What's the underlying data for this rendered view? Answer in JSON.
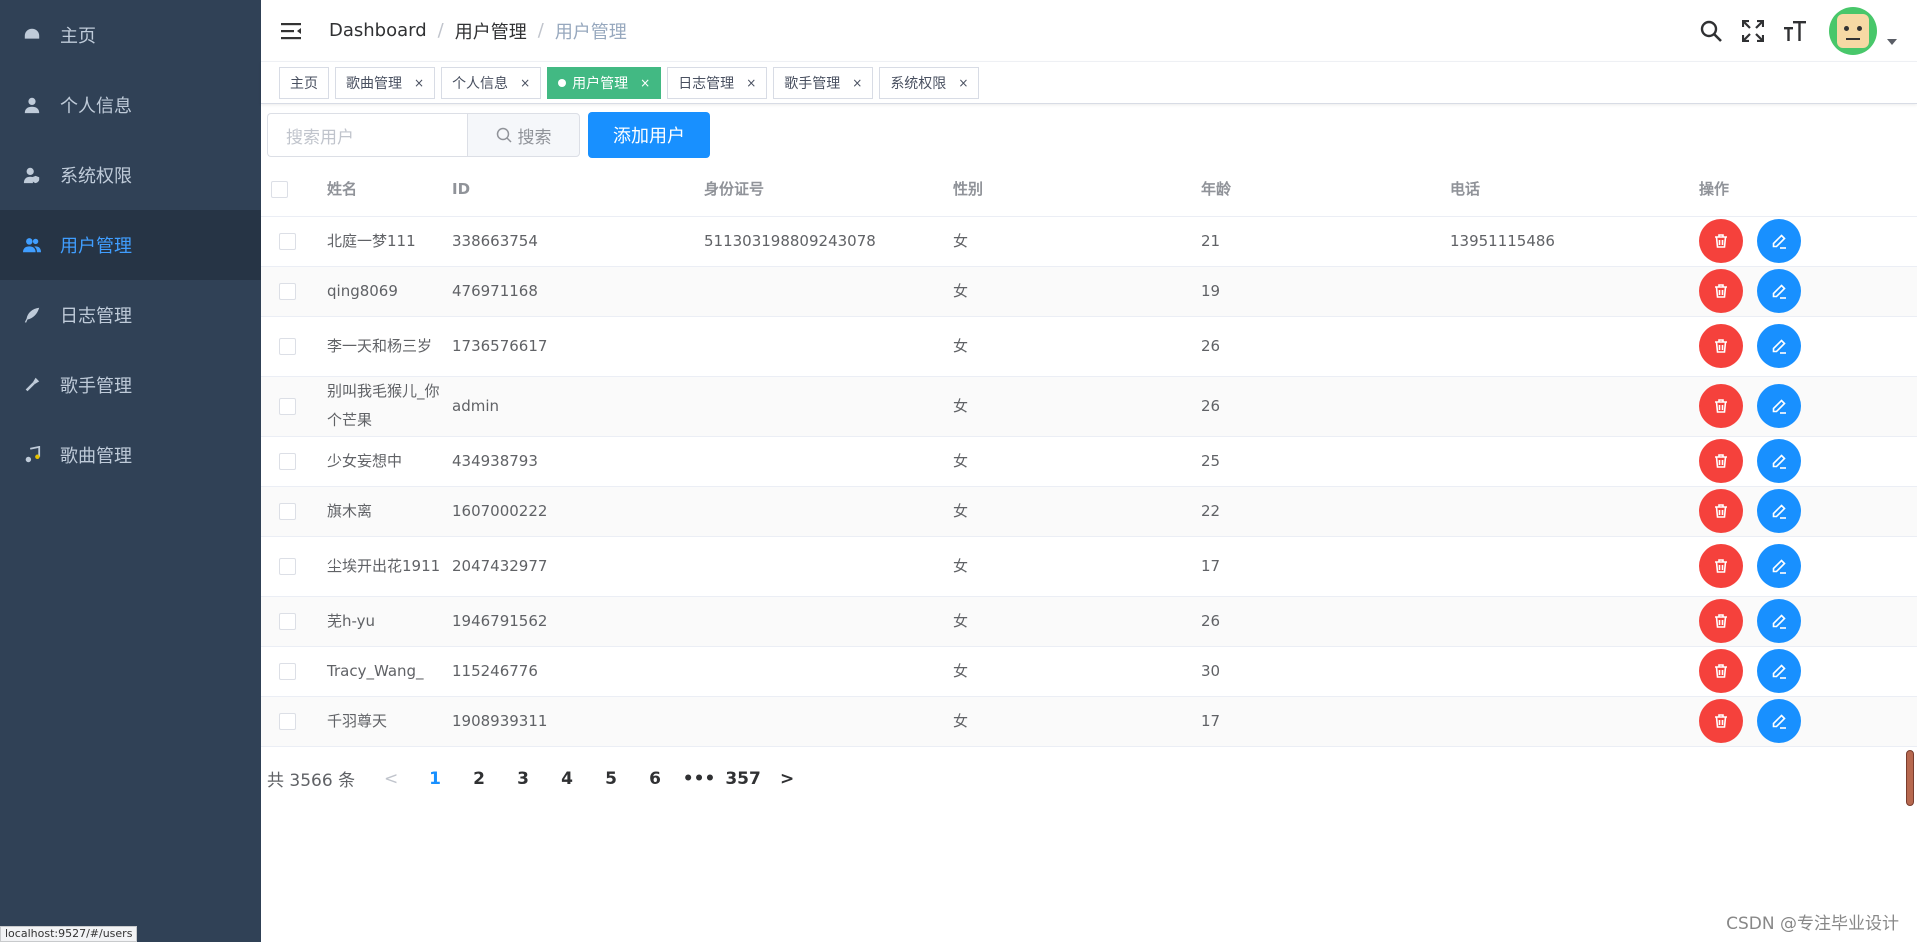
{
  "sidebar": {
    "items": [
      {
        "label": "主页",
        "icon": "dashboard-icon",
        "active": false
      },
      {
        "label": "个人信息",
        "icon": "user-icon",
        "active": false
      },
      {
        "label": "系统权限",
        "icon": "user-shield-icon",
        "active": false
      },
      {
        "label": "用户管理",
        "icon": "users-icon",
        "active": true
      },
      {
        "label": "日志管理",
        "icon": "feather-icon",
        "active": false
      },
      {
        "label": "歌手管理",
        "icon": "microphone-icon",
        "active": false
      },
      {
        "label": "歌曲管理",
        "icon": "music-icon",
        "active": false
      }
    ],
    "bg_color": "#304156",
    "active_color": "#409eff"
  },
  "breadcrumb": [
    "Dashboard",
    "用户管理",
    "用户管理"
  ],
  "tags": [
    {
      "label": "主页",
      "closable": false,
      "active": false
    },
    {
      "label": "歌曲管理",
      "closable": true,
      "active": false
    },
    {
      "label": "个人信息",
      "closable": true,
      "active": false
    },
    {
      "label": "用户管理",
      "closable": true,
      "active": true
    },
    {
      "label": "日志管理",
      "closable": true,
      "active": false
    },
    {
      "label": "歌手管理",
      "closable": true,
      "active": false
    },
    {
      "label": "系统权限",
      "closable": true,
      "active": false
    }
  ],
  "toolbar": {
    "search_placeholder": "搜索用户",
    "search_button": "搜索",
    "add_button": "添加用户"
  },
  "table": {
    "headers": [
      "姓名",
      "ID",
      "身份证号",
      "性别",
      "年龄",
      "电话",
      "操作"
    ],
    "rows": [
      {
        "name": "北庭一梦111",
        "id": "338663754",
        "idcard": "511303198809243078",
        "gender": "女",
        "age": "21",
        "phone": "13951115486"
      },
      {
        "name": "qing8069",
        "id": "476971168",
        "idcard": "",
        "gender": "女",
        "age": "19",
        "phone": ""
      },
      {
        "name": "李一天和杨三岁",
        "id": "1736576617",
        "idcard": "",
        "gender": "女",
        "age": "26",
        "phone": ""
      },
      {
        "name": "别叫我毛猴儿_你个芒果",
        "id": "admin",
        "idcard": "",
        "gender": "女",
        "age": "26",
        "phone": ""
      },
      {
        "name": "少女妄想中",
        "id": "434938793",
        "idcard": "",
        "gender": "女",
        "age": "25",
        "phone": ""
      },
      {
        "name": "旗木离",
        "id": "1607000222",
        "idcard": "",
        "gender": "女",
        "age": "22",
        "phone": ""
      },
      {
        "name": "尘埃开出花1911",
        "id": "2047432977",
        "idcard": "",
        "gender": "女",
        "age": "17",
        "phone": ""
      },
      {
        "name": "芜h-yu",
        "id": "1946791562",
        "idcard": "",
        "gender": "女",
        "age": "26",
        "phone": ""
      },
      {
        "name": "Tracy_Wang_",
        "id": "115246776",
        "idcard": "",
        "gender": "女",
        "age": "30",
        "phone": ""
      },
      {
        "name": "千羽尊天",
        "id": "1908939311",
        "idcard": "",
        "gender": "女",
        "age": "17",
        "phone": ""
      }
    ]
  },
  "pagination": {
    "total_text": "共 3566 条",
    "pages": [
      "1",
      "2",
      "3",
      "4",
      "5",
      "6",
      "•••",
      "357"
    ],
    "current": "1",
    "prev": "<",
    "next": ">"
  },
  "status_url": "localhost:9527/#/users",
  "watermark": "CSDN @专注毕业设计",
  "colors": {
    "tag_active": "#42b983",
    "primary": "#1890ff",
    "danger": "#f5413c"
  }
}
